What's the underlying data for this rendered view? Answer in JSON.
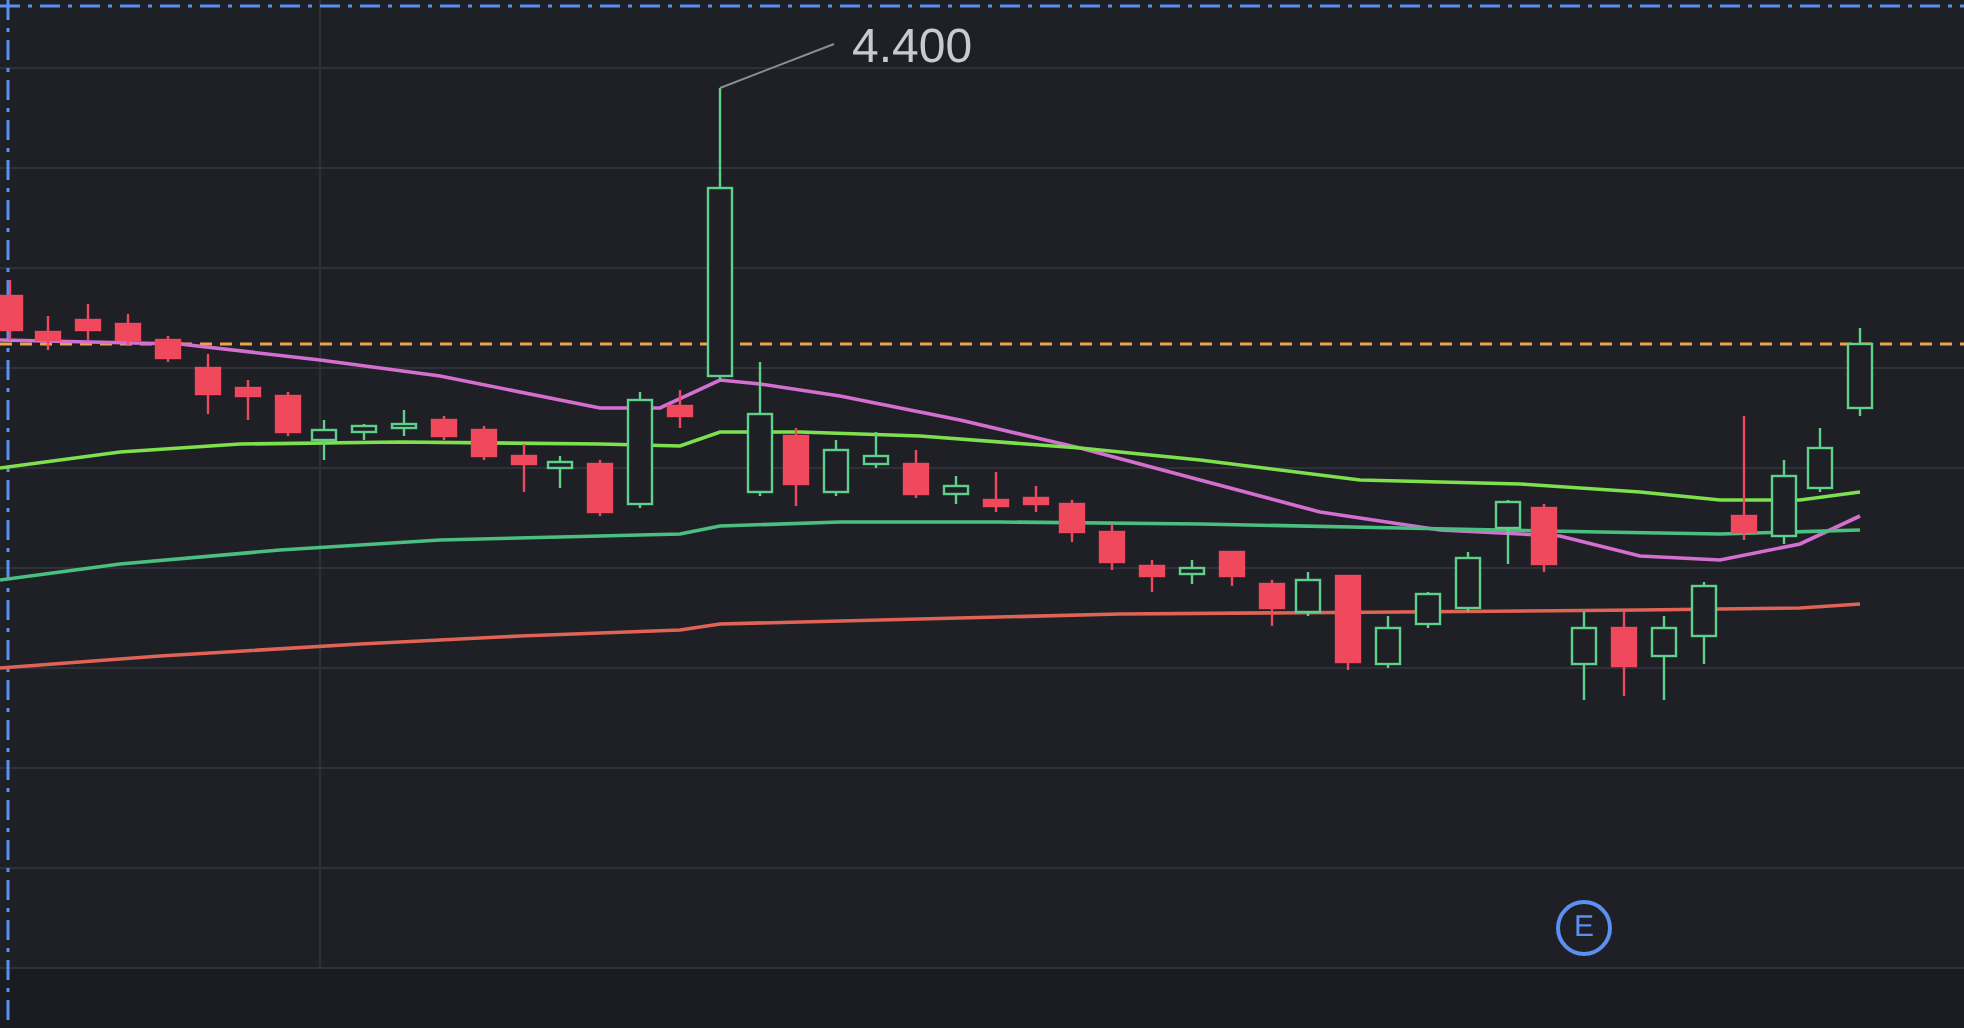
{
  "price_label": {
    "text": "4.400"
  },
  "event_marker": {
    "text": "E"
  }
}
